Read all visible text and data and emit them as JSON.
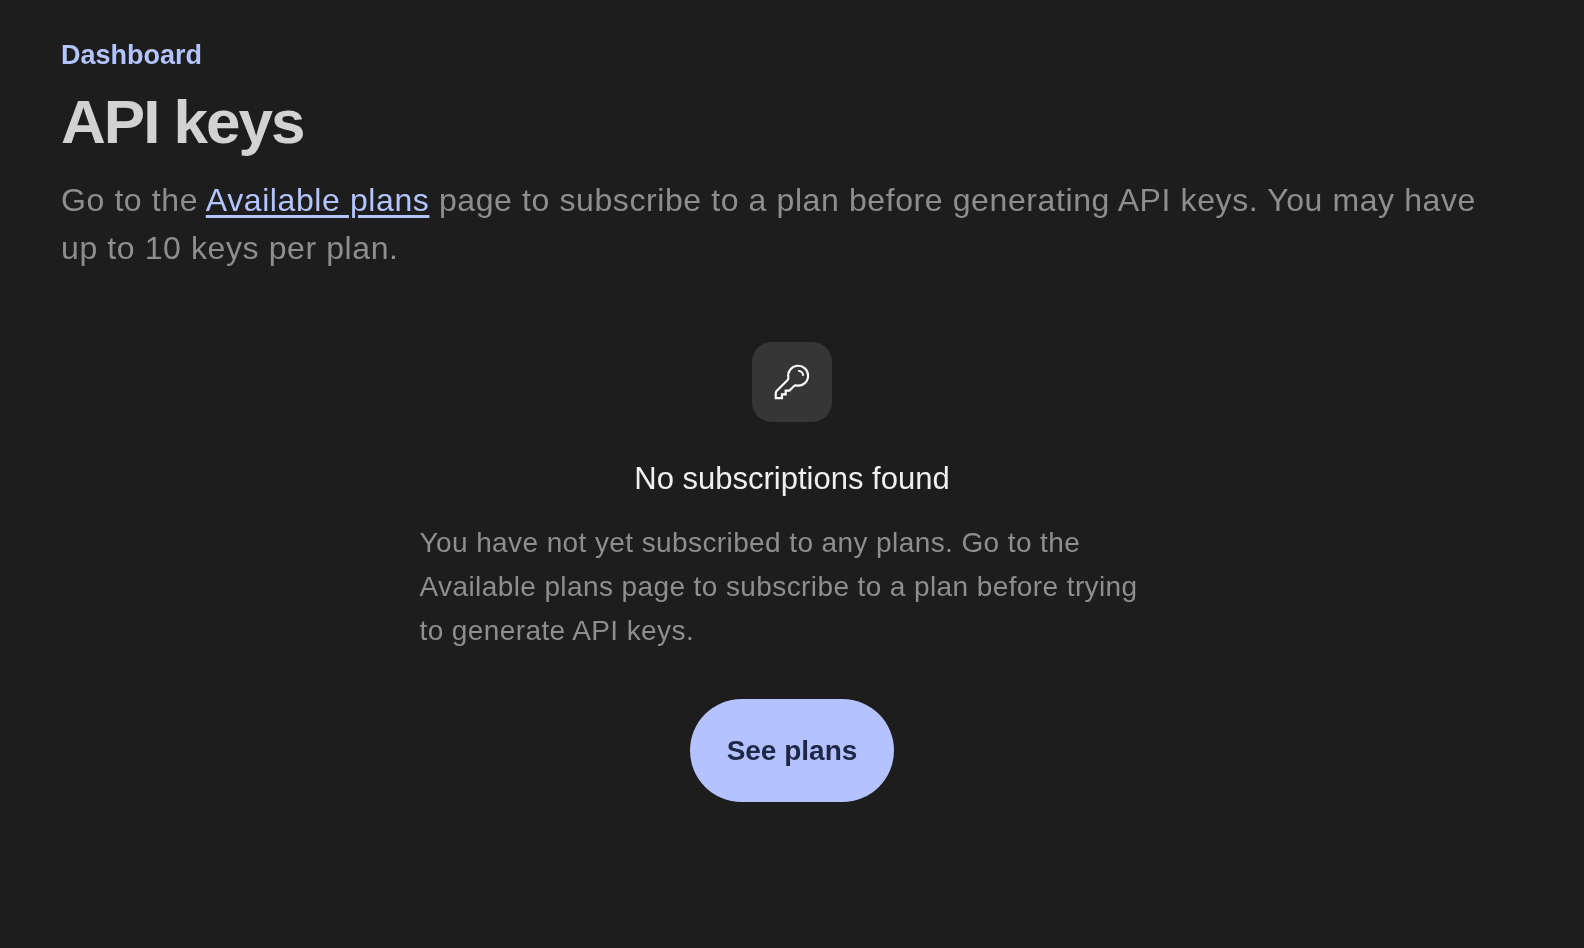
{
  "breadcrumb": {
    "label": "Dashboard"
  },
  "title": "API keys",
  "intro": {
    "before": "Go to the ",
    "link": "Available plans",
    "after": " page to subscribe to a plan before generating API keys. You may have up to 10 keys per plan."
  },
  "empty_state": {
    "title": "No subscriptions found",
    "description": "You have not yet subscribed to any plans. Go to the Available plans page to subscribe to a plan before trying to generate API keys.",
    "button": "See plans"
  }
}
